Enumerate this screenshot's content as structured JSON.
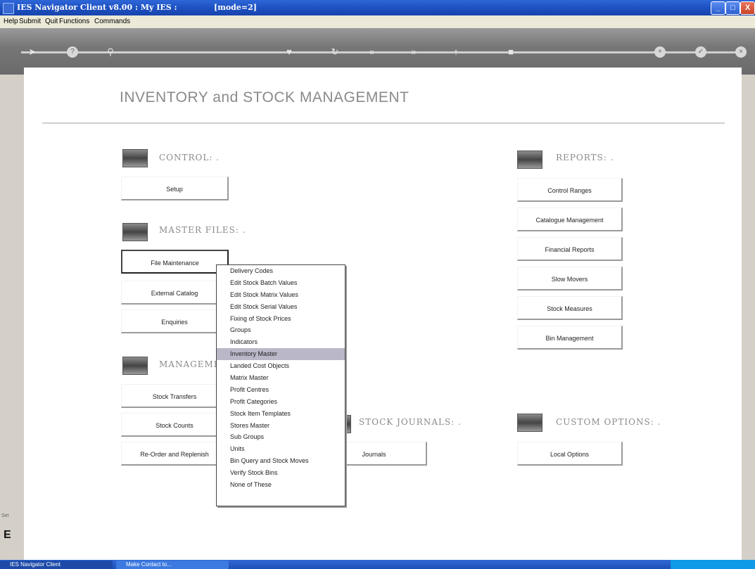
{
  "window": {
    "title": "IES Navigator Client v8.00 : My IES :",
    "mode": "[mode=2]",
    "minimize": "_",
    "maximize": "□",
    "close": "X"
  },
  "menubar": {
    "items": [
      "Help",
      "Submit",
      "Quit",
      "Functions",
      "Commands"
    ]
  },
  "toolbar": {
    "icons": [
      "arrow-icon",
      "help-icon",
      "search-icon",
      "heart-icon",
      "refresh-icon",
      "back-icon",
      "forward-icon",
      "up-icon",
      "stop-icon",
      "plus-icon",
      "check-icon",
      "close-icon"
    ]
  },
  "page": {
    "title": "INVENTORY and STOCK MANAGEMENT"
  },
  "sections": {
    "control": "CONTROL: .",
    "master_files": "MASTER FILES: .",
    "management": "MANAGEME",
    "stock_journals": "STOCK JOURNALS: .",
    "reports": "REPORTS: .",
    "custom_options": "CUSTOM OPTIONS: ."
  },
  "buttons": {
    "setup": "Setup",
    "file_maintenance": "File Maintenance",
    "external_catalog": "External Catalog",
    "enquiries": "Enquiries",
    "stock_transfers": "Stock Transfers",
    "stock_counts": "Stock Counts",
    "reorder": "Re-Order and Replenish",
    "journals": "Journals",
    "control_ranges": "Control Ranges",
    "catalogue_management": "Catalogue Management",
    "financial_reports": "Financial Reports",
    "slow_movers": "Slow Movers",
    "stock_measures": "Stock Measures",
    "bin_management": "Bin Management",
    "local_options": "Local Options"
  },
  "popup_menu": {
    "items": [
      "Delivery Codes",
      "Edit Stock Batch Values",
      "Edit Stock Matrix Values",
      "Edit Stock Serial Values",
      "Fixing of Stock Prices",
      "Groups",
      "Indicators",
      "Inventory Master",
      "Landed Cost Objects",
      "Matrix Master",
      "Profit Centres",
      "Profit Categories",
      "Stock Item Templates",
      "Stores Master",
      "Sub Groups",
      "Units",
      "Bin Query and Stock Moves",
      "Verify Stock Bins",
      "None of These"
    ],
    "highlighted_index": 7
  },
  "stub": {
    "letter": "E",
    "small": "Set"
  },
  "taskbar": {
    "task1": "IES Navigator Client",
    "task2": "Make Contact to..."
  }
}
